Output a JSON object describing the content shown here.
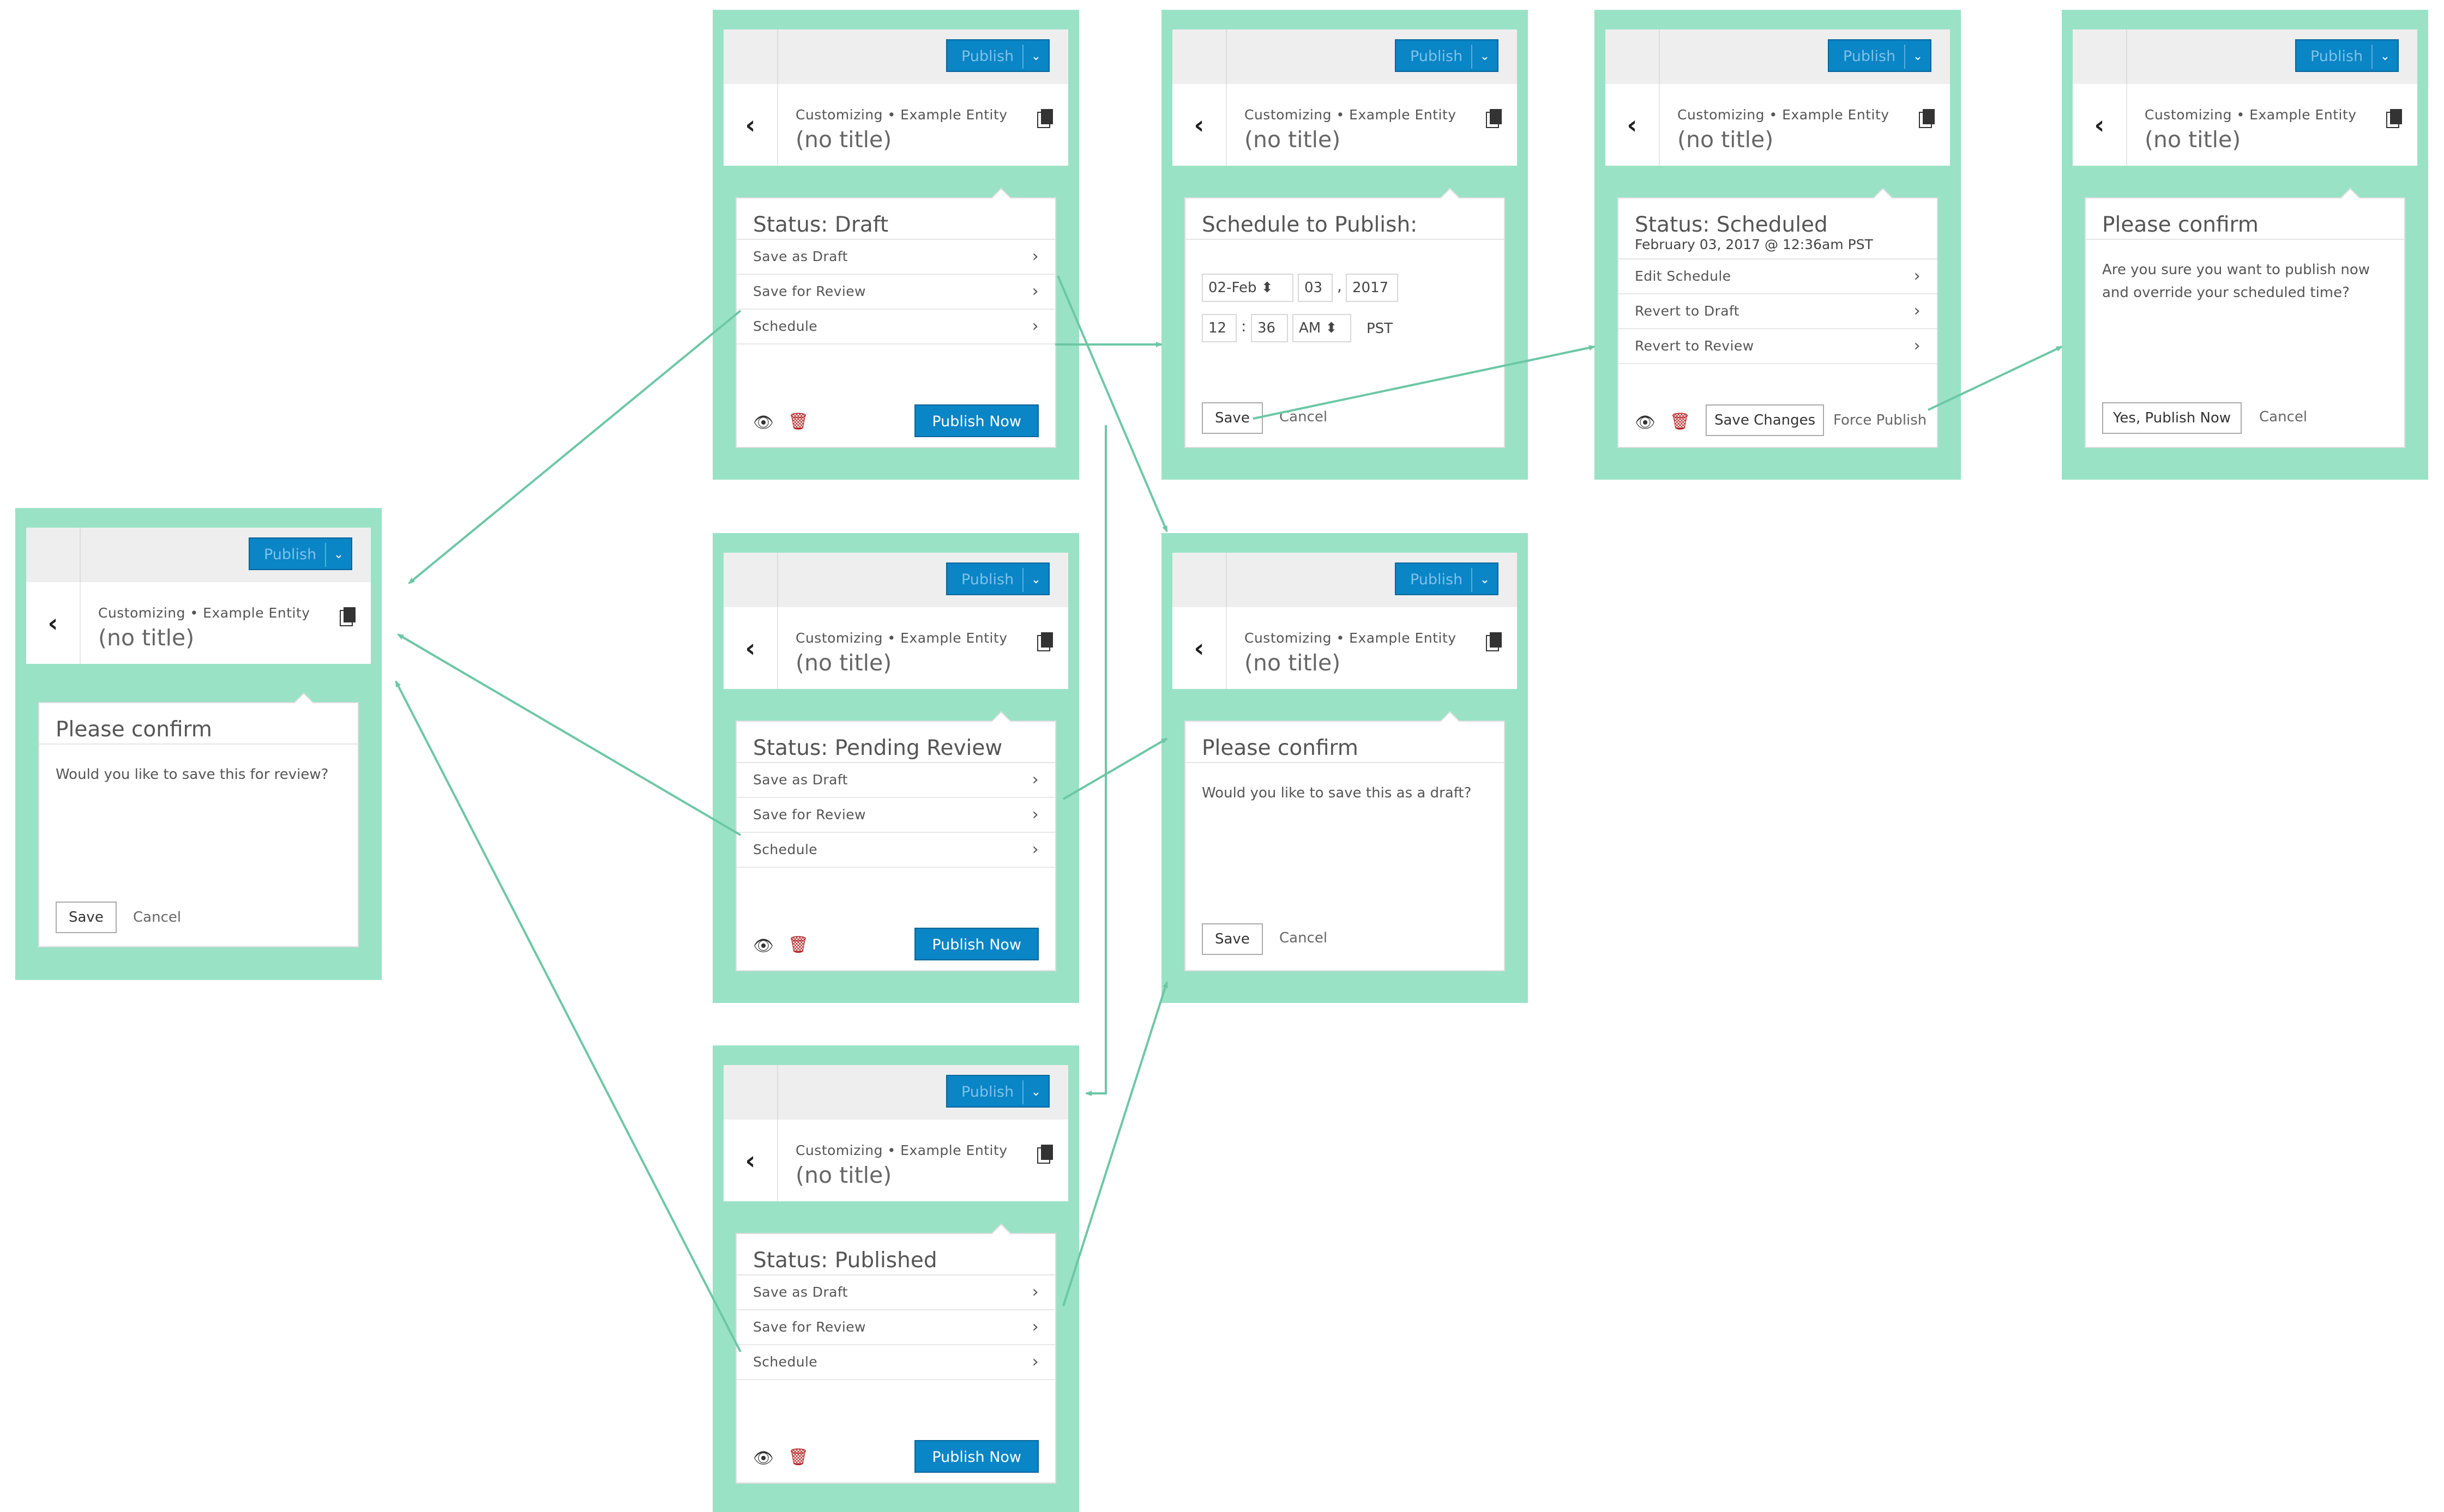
{
  "common": {
    "publish_label": "Publish",
    "caret": "⌄",
    "back": "‹",
    "breadcrumb": "Customizing • Example Entity",
    "post_title": "(no title)",
    "eye": "👁",
    "trash": "🗑",
    "chevron": "›"
  },
  "draft": {
    "status": "Status: Draft",
    "menu": [
      "Save as Draft",
      "Save for Review",
      "Schedule"
    ],
    "publish_now": "Publish Now"
  },
  "pending": {
    "status": "Status: Pending Review",
    "menu": [
      "Save as Draft",
      "Save for Review",
      "Schedule"
    ],
    "publish_now": "Publish Now"
  },
  "published": {
    "status": "Status: Published",
    "menu": [
      "Save as Draft",
      "Save for Review",
      "Schedule"
    ],
    "publish_now": "Publish Now"
  },
  "schedule": {
    "title": "Schedule to Publish:",
    "month": "02-Feb",
    "day": "03",
    "comma": ",",
    "year": "2017",
    "hour": "12",
    "colon": ":",
    "minute": "36",
    "ampm": "AM",
    "tz": "PST",
    "save": "Save",
    "cancel": "Cancel"
  },
  "scheduled": {
    "status": "Status: Scheduled",
    "date": "February 03, 2017 @ 12:36am PST",
    "menu": [
      "Edit Schedule",
      "Revert to Draft",
      "Revert to Review"
    ],
    "save_changes": "Save Changes",
    "force_publish": "Force Publish"
  },
  "confirm_publish": {
    "title": "Please confirm",
    "message": "Are you sure you want to publish now and override your scheduled time?",
    "yes": "Yes, Publish Now",
    "cancel": "Cancel"
  },
  "confirm_review": {
    "title": "Please confirm",
    "message": "Would you like to save this for review?",
    "save": "Save",
    "cancel": "Cancel"
  },
  "confirm_draft": {
    "title": "Please confirm",
    "message": "Would you like to save this as a draft?",
    "save": "Save",
    "cancel": "Cancel"
  }
}
